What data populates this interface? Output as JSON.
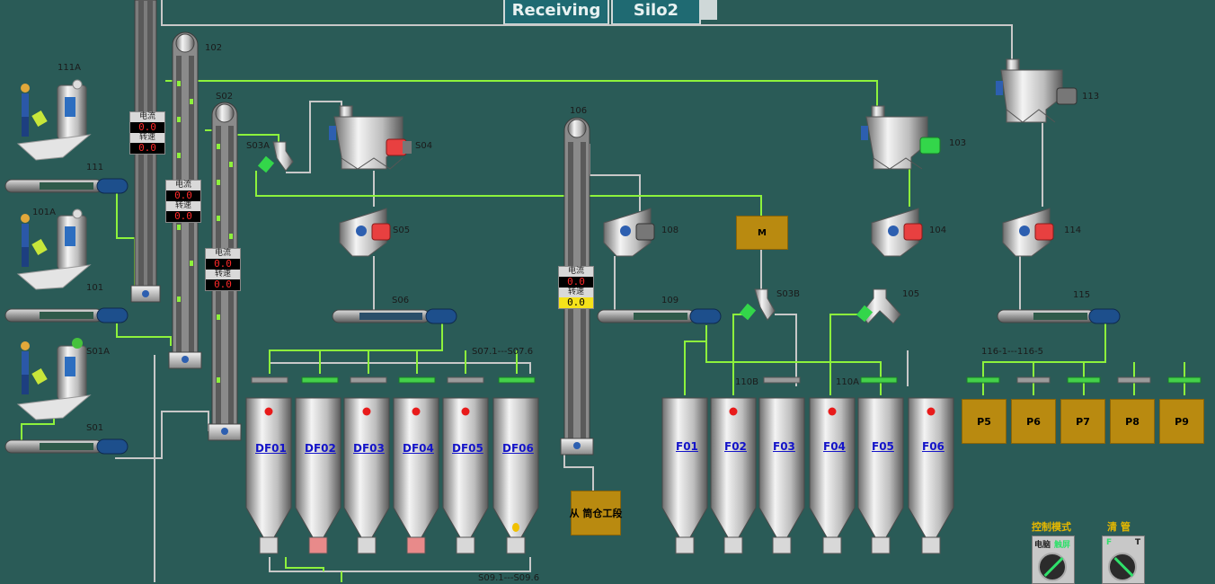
{
  "top_buttons": [
    "Receiving",
    "Silo2"
  ],
  "panel_labels": {
    "current": "电流",
    "speed": "转速"
  },
  "panels": [
    {
      "current": "0.0",
      "speed": "0.0"
    },
    {
      "current": "0.0",
      "speed": "0.0"
    },
    {
      "current": "0.0",
      "speed": "0.0"
    },
    {
      "current": "0.0",
      "speed": "0.0"
    }
  ],
  "equipment_labels": {
    "e111A": "111A",
    "e101A": "101A",
    "eS01A": "S01A",
    "e111": "111",
    "e101": "101",
    "eS01": "S01",
    "e102": "102",
    "eS02": "S02",
    "eS03A": "S03A",
    "eS04": "S04",
    "eS05": "S05",
    "eS06": "S06",
    "eS07": "S07.1---S07.6",
    "e106": "106",
    "e108": "108",
    "e109": "109",
    "eS03B": "S03B",
    "e110B": "110B",
    "e103": "103",
    "e104": "104",
    "e105": "105",
    "e110A": "110A",
    "e113": "113",
    "e114": "114",
    "e115": "115",
    "e116": "116-1---116-5",
    "eS09": "S09.1---S09.6"
  },
  "motor_label": "M",
  "transfer_box": "从 筒仓工段",
  "df_silos": [
    "DF01",
    "DF02",
    "DF03",
    "DF04",
    "DF05",
    "DF06"
  ],
  "f_silos": [
    "F01",
    "F02",
    "F03",
    "F04",
    "F05",
    "F06"
  ],
  "p_bins": [
    "P5",
    "P6",
    "P7",
    "P8",
    "P9"
  ],
  "control_mode": {
    "title": "控制模式",
    "left": "电脑",
    "right": "触屏"
  },
  "pipe_clean": {
    "title": "清 管",
    "left": "F",
    "right": "T"
  },
  "colors": {
    "background": "#2a5b57",
    "active_line": "#8df23c",
    "idle_line": "#c8c8c8",
    "motor_red": "#e84040",
    "motor_green": "#33d64a",
    "bin": "#b98a10",
    "silo_name": "#1414c8"
  }
}
